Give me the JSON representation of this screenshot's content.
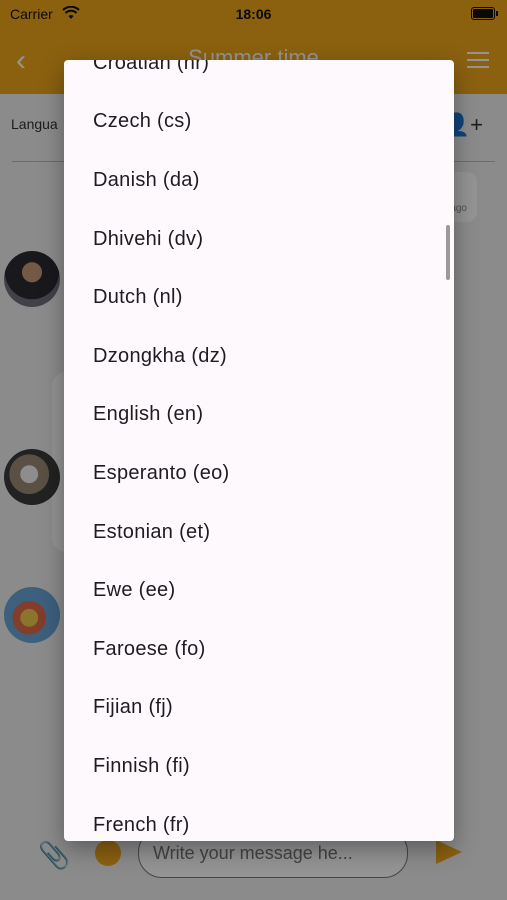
{
  "status_bar": {
    "carrier": "Carrier",
    "time": "18:06"
  },
  "header": {
    "title": "Summer time"
  },
  "language_row": {
    "label": "Langua"
  },
  "message": {
    "timestamp": "ago"
  },
  "composer": {
    "placeholder": "Write your message he..."
  },
  "language_picker": {
    "options": [
      "Croatian (hr)",
      "Czech (cs)",
      "Danish (da)",
      "Dhivehi (dv)",
      "Dutch (nl)",
      "Dzongkha (dz)",
      "English (en)",
      "Esperanto (eo)",
      "Estonian (et)",
      "Ewe (ee)",
      "Faroese (fo)",
      "Fijian (fj)",
      "Finnish (fi)",
      "French (fr)"
    ]
  },
  "colors": {
    "accent": "#f0a81c",
    "dialog_bg": "#fdf9fd",
    "text": "#1e1b22"
  },
  "icons": [
    "wifi-icon",
    "battery-icon",
    "back-icon",
    "menu-icon",
    "add-user-icon",
    "attach-icon",
    "emoji-icon",
    "send-icon"
  ]
}
